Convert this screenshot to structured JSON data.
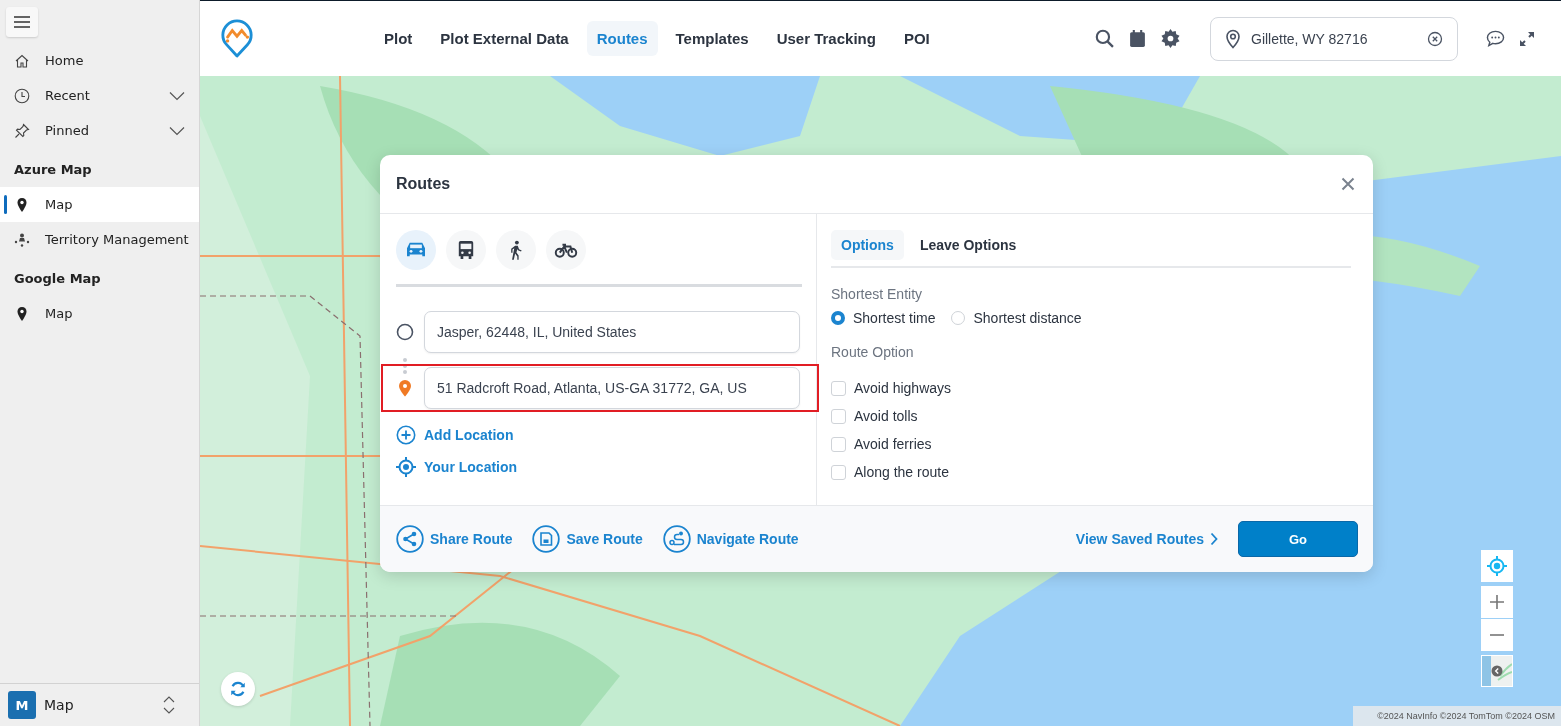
{
  "sidebar": {
    "items": [
      {
        "label": "Home",
        "selected": false
      },
      {
        "label": "Recent",
        "selected": false,
        "expanded": false
      },
      {
        "label": "Pinned",
        "selected": false,
        "expanded": false
      }
    ],
    "sections": [
      {
        "heading": "Azure Map",
        "items": [
          {
            "label": "Map",
            "selected": true
          },
          {
            "label": "Territory Management",
            "selected": false
          }
        ]
      },
      {
        "heading": "Google Map",
        "items": [
          {
            "label": "Map",
            "selected": false
          }
        ]
      }
    ],
    "footer": {
      "badge": "M",
      "label": "Map"
    }
  },
  "nav_tabs": [
    {
      "label": "Plot",
      "selected": false
    },
    {
      "label": "Plot External Data",
      "selected": false
    },
    {
      "label": "Routes",
      "selected": true
    },
    {
      "label": "Templates",
      "selected": false
    },
    {
      "label": "User Tracking",
      "selected": false
    },
    {
      "label": "POI",
      "selected": false
    }
  ],
  "location_search": {
    "value": "Gillette, WY 82716"
  },
  "routes_dialog": {
    "title": "Routes",
    "travel_modes": [
      {
        "selected": true
      },
      {
        "selected": false
      },
      {
        "selected": false
      },
      {
        "selected": false
      }
    ],
    "locations": [
      {
        "kind": "origin",
        "value": "Jasper, 62448, IL, United States",
        "highlighted": false
      },
      {
        "kind": "destination",
        "value": "51 Radcroft Road, Atlanta, US-GA 31772, GA, US",
        "highlighted": true
      }
    ],
    "links": [
      "Add Location",
      "Your Location"
    ],
    "option_tabs": [
      {
        "label": "Options",
        "selected": true
      },
      {
        "label": "Leave Options",
        "selected": false
      }
    ],
    "shortest_entity": {
      "label": "Shortest Entity",
      "options": [
        {
          "label": "Shortest time",
          "selected": true
        },
        {
          "label": "Shortest distance",
          "selected": false
        }
      ]
    },
    "route_option": {
      "label": "Route Option",
      "options": [
        {
          "label": "Avoid highways",
          "checked": false
        },
        {
          "label": "Avoid tolls",
          "checked": false
        },
        {
          "label": "Avoid ferries",
          "checked": false
        },
        {
          "label": "Along the route",
          "checked": false
        }
      ]
    },
    "actions": [
      "Share Route",
      "Save Route",
      "Navigate Route"
    ],
    "view_saved": "View Saved Routes",
    "go": "Go"
  },
  "attribution": "©2024 NavInfo ©2024 TomTom ©2024 OSM"
}
